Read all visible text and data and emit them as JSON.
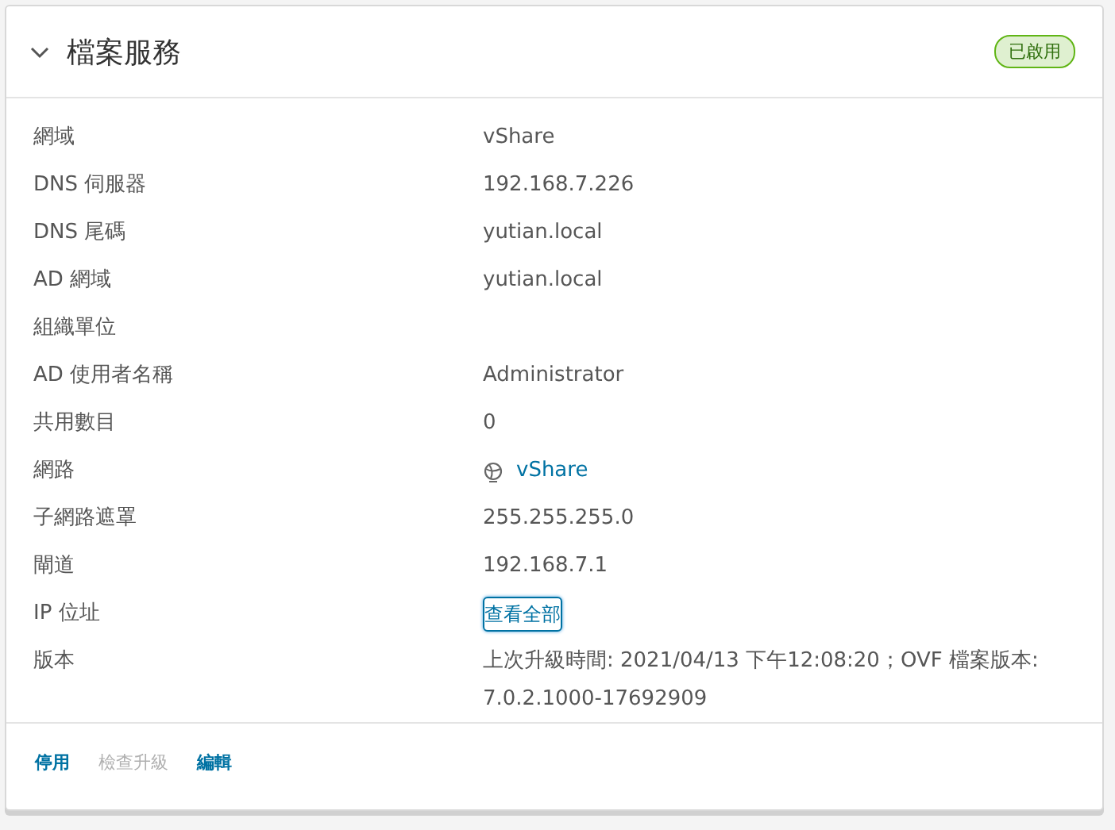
{
  "card": {
    "title": "檔案服務",
    "expanded": true,
    "status": "已啟用"
  },
  "rows": [
    {
      "label": "網域",
      "kind": "text",
      "value": "vShare"
    },
    {
      "label": "DNS 伺服器",
      "kind": "text",
      "value": "192.168.7.226"
    },
    {
      "label": "DNS 尾碼",
      "kind": "text",
      "value": "yutian.local"
    },
    {
      "label": "AD 網域",
      "kind": "text",
      "value": "yutian.local"
    },
    {
      "label": "組織單位",
      "kind": "empty"
    },
    {
      "label": "AD 使用者名稱",
      "kind": "text",
      "value": "Administrator"
    },
    {
      "label": "共用數目",
      "kind": "text",
      "value": "0"
    },
    {
      "label": "網路",
      "kind": "link",
      "value": "vShare"
    },
    {
      "label": "子網路遮罩",
      "kind": "text",
      "value": "255.255.255.0"
    },
    {
      "label": "閘道",
      "kind": "text",
      "value": "192.168.7.1"
    },
    {
      "label": "IP 位址",
      "kind": "button",
      "value": "查看全部"
    },
    {
      "label": "版本",
      "kind": "text",
      "value": "上次升級時間: 2021/04/13 下午12:08:20；OVF 檔案版本: 7.0.2.1000-17692909"
    }
  ],
  "actions": [
    {
      "label": "停用",
      "disabled": false
    },
    {
      "label": "檢查升級",
      "disabled": true
    },
    {
      "label": "編輯",
      "disabled": false
    }
  ]
}
